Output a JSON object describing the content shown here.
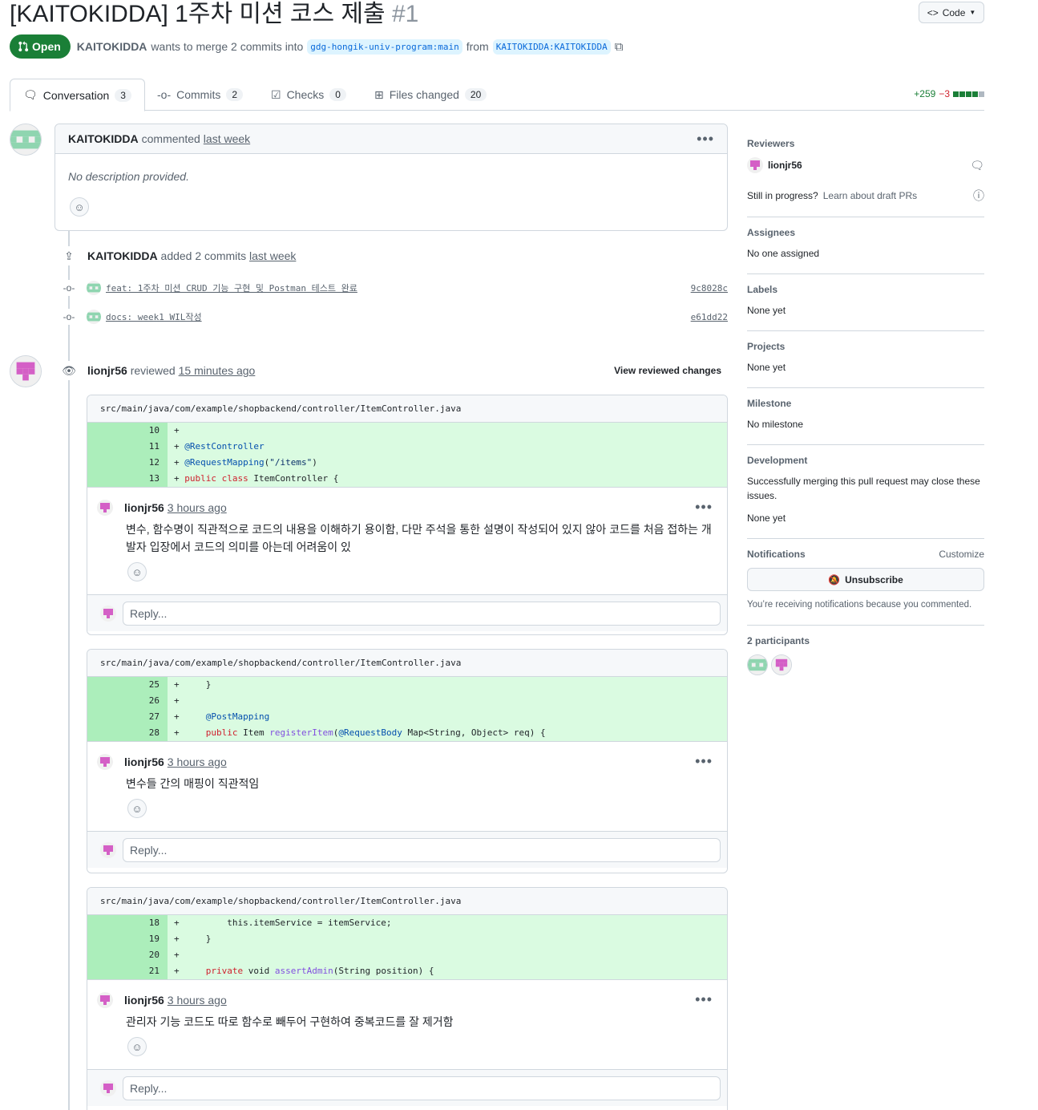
{
  "pr": {
    "title": "[KAITOKIDDA] 1주차 미션 코스 제출",
    "number": "#1",
    "state": "Open",
    "author": "KAITOKIDDA",
    "merge_text": "wants to merge 2 commits into",
    "base_branch": "gdg-hongik-univ-program:main",
    "from_text": "from",
    "head_branch": "KAITOKIDDA:KAITOKIDDA",
    "code_button": "Code"
  },
  "tabs": [
    {
      "label": "Conversation",
      "count": "3"
    },
    {
      "label": "Commits",
      "count": "2"
    },
    {
      "label": "Checks",
      "count": "0"
    },
    {
      "label": "Files changed",
      "count": "20"
    }
  ],
  "diffstat": {
    "additions": "+259",
    "deletions": "−3",
    "colors": [
      "#1a7f37",
      "#1a7f37",
      "#1a7f37",
      "#1a7f37",
      "#afb8c1"
    ]
  },
  "first_comment": {
    "author": "KAITOKIDDA",
    "action": "commented",
    "time": "last week",
    "body": "No description provided."
  },
  "commits_event": {
    "author": "KAITOKIDDA",
    "action": "added 2 commits",
    "time": "last week",
    "commits": [
      {
        "message": "feat: 1주차 미션 CRUD 기능 구현 및 Postman 테스트 완료",
        "sha": "9c8028c"
      },
      {
        "message": "docs: week1 WIL작성",
        "sha": "e61dd22"
      }
    ]
  },
  "review": {
    "author": "lionjr56",
    "action": "reviewed",
    "time": "15 minutes ago",
    "view_changes": "View reviewed changes",
    "reply_placeholder": "Reply...",
    "threads": [
      {
        "path": "src/main/java/com/example/shopbackend/controller/ItemController.java",
        "lines": [
          "10",
          "11",
          "12",
          "13"
        ],
        "author": "lionjr56",
        "time": "3 hours ago",
        "body": "변수, 함수명이 직관적으로 코드의 내용을 이해하기 용이함, 다만 주석을 통한 설명이 작성되어 있지 않아 코드를 처음 접하는 개발자 입장에서 코드의 의미를 아는데 어려움이 있"
      },
      {
        "path": "src/main/java/com/example/shopbackend/controller/ItemController.java",
        "lines": [
          "25",
          "26",
          "27",
          "28"
        ],
        "author": "lionjr56",
        "time": "3 hours ago",
        "body": "변수들 간의 매핑이 직관적임"
      },
      {
        "path": "src/main/java/com/example/shopbackend/controller/ItemController.java",
        "lines": [
          "18",
          "19",
          "20",
          "21"
        ],
        "author": "lionjr56",
        "time": "3 hours ago",
        "body": "관리자 기능 코드도 따로 함수로 빼두어 구현하여 중복코드를 잘 제거함"
      }
    ]
  },
  "sidebar": {
    "reviewers_title": "Reviewers",
    "reviewer": "lionjr56",
    "draft_question": "Still in progress?",
    "draft_link": "Learn about draft PRs",
    "assignees_title": "Assignees",
    "assignees_value": "No one assigned",
    "labels_title": "Labels",
    "labels_value": "None yet",
    "projects_title": "Projects",
    "projects_value": "None yet",
    "milestone_title": "Milestone",
    "milestone_value": "No milestone",
    "development_title": "Development",
    "development_text": "Successfully merging this pull request may close these issues.",
    "development_value": "None yet",
    "notifications_title": "Notifications",
    "customize": "Customize",
    "unsubscribe": "Unsubscribe",
    "notification_reason": "You’re receiving notifications because you commented.",
    "participants_title": "2 participants"
  },
  "avatar_colors": {
    "kaitokidda": "#8fd5b0",
    "lionjr56": "#d45fc6"
  }
}
